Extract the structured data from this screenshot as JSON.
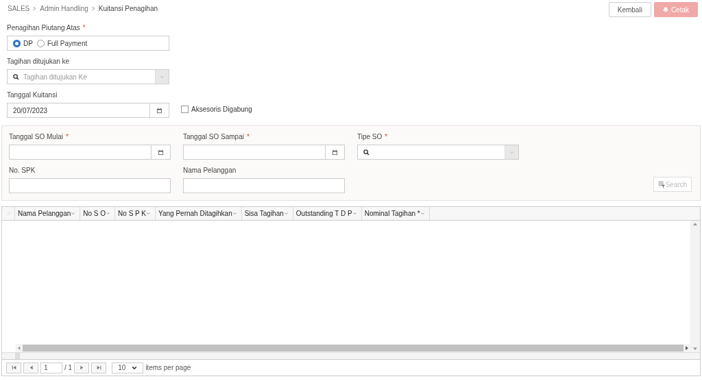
{
  "breadcrumb": [
    "SALES",
    "Admin Handling",
    "Kuitansi Penagihan"
  ],
  "buttons": [
    {
      "label": "Kembali",
      "kind": "default",
      "disabled": false
    },
    {
      "label": "Cetak",
      "kind": "print",
      "disabled": true
    }
  ],
  "payment_type": {
    "label": "Penagihan Piutang Atas",
    "required_mark": "*",
    "options": [
      {
        "label": "DP",
        "selected": true
      },
      {
        "label": "Full Payment",
        "selected": false
      }
    ]
  },
  "bill_to": {
    "label": "Tagihan ditujukan ke",
    "placeholder": "Tagihan ditujukan Ke"
  },
  "receipt_date": {
    "label": "Tanggal Kuitansi",
    "value": "20/07/2023"
  },
  "accessories_merged": {
    "label": "Aksesoris Digabung",
    "checked": false
  },
  "filters": [
    {
      "label": "Tanggal SO Mulai",
      "required_mark": "*",
      "kind": "date"
    },
    {
      "label": "Tanggal SO Sampai",
      "required_mark": "*",
      "kind": "date"
    },
    {
      "label": "Tipe SO",
      "required_mark": "*",
      "kind": "select"
    },
    {
      "label": "No. SPK",
      "kind": "text"
    },
    {
      "label": "Nama Pelanggan",
      "kind": "text"
    }
  ],
  "search_button": {
    "label": "Search",
    "disabled": true
  },
  "table": {
    "columns": [
      "Nama Pelanggan",
      "No S O",
      "No S P K",
      "Yang Pernah Ditagihkan",
      "Sisa Tagihan",
      "Outstanding T D P",
      "Nominal Tagihan *"
    ]
  },
  "pager": {
    "page": "1",
    "of": "/ 1",
    "page_size": "10",
    "page_size_label": "items per page"
  }
}
